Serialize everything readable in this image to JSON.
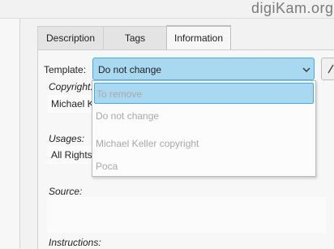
{
  "window": {
    "title": "digiKam.org"
  },
  "tabs": [
    {
      "label": "Description"
    },
    {
      "label": "Tags"
    },
    {
      "label": "Information"
    }
  ],
  "template": {
    "label": "Template:",
    "selected": "Do not change",
    "options": [
      "To remove",
      "Do not change",
      "Michael Keller copyright",
      "Poca"
    ]
  },
  "fields": {
    "copyright": {
      "label": "Copyright:",
      "value": "Michael K"
    },
    "usages": {
      "label": "Usages:",
      "value": "All Rights"
    },
    "source": {
      "label": "Source:"
    },
    "instructions": {
      "label": "Instructions:"
    }
  },
  "colors": {
    "accent": "#3daee9",
    "highlight": "#a9d9f1",
    "disabled_text": "#a8a8a8"
  },
  "icons": {
    "dropdown": "chevron-down-icon",
    "edit": "pen-icon"
  }
}
